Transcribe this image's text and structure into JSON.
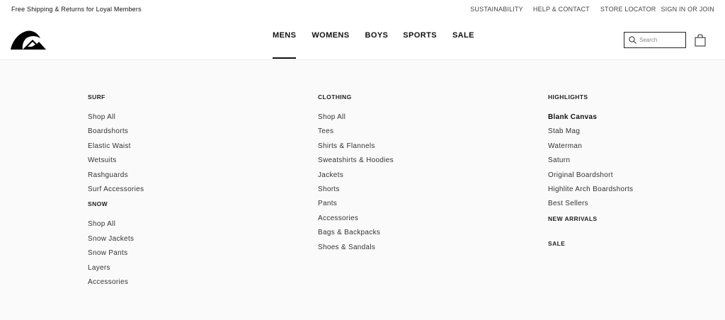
{
  "topbar": {
    "promo": "Free Shipping & Returns for Loyal Members",
    "links": [
      "SUSTAINABILITY",
      "HELP & CONTACT",
      "STORE LOCATOR",
      "SIGN IN OR JOIN"
    ]
  },
  "nav": {
    "items": [
      "MENS",
      "WOMENS",
      "BOYS",
      "SPORTS",
      "SALE"
    ],
    "active": "MENS"
  },
  "search": {
    "placeholder": "Search"
  },
  "icons": {
    "logo": "quiksilver-logo",
    "search": "search-icon",
    "bag": "shopping-bag-icon"
  },
  "menu": {
    "surf": {
      "heading": "SURF",
      "items": [
        "Shop All",
        "Boardshorts",
        "Elastic Waist",
        "Wetsuits",
        "Rashguards",
        "Surf Accessories"
      ]
    },
    "snow": {
      "heading": "SNOW",
      "items": [
        "Shop All",
        "Snow Jackets",
        "Snow Pants",
        "Layers",
        "Accessories"
      ]
    },
    "clothing": {
      "heading": "CLOTHING",
      "items": [
        "Shop All",
        "Tees",
        "Shirts & Flannels",
        "Sweatshirts & Hoodies",
        "Jackets",
        "Shorts",
        "Pants",
        "Accessories",
        "Bags & Backpacks",
        "Shoes & Sandals"
      ]
    },
    "highlights": {
      "heading": "HIGHLIGHTS",
      "items": [
        "Blank Canvas",
        "Stab Mag",
        "Waterman",
        "Saturn",
        "Original Boardshort",
        "Highlite Arch Boardshorts",
        "Best Sellers"
      ]
    },
    "new_arrivals": {
      "heading": "NEW ARRIVALS"
    },
    "sale": {
      "heading": "SALE"
    }
  }
}
